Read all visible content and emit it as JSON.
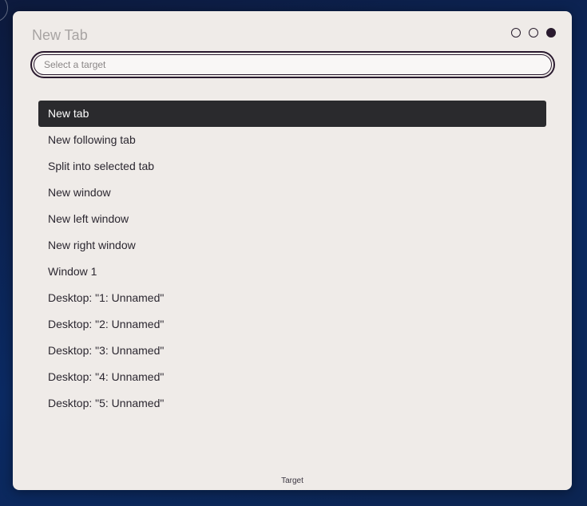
{
  "dialog": {
    "title": "New Tab",
    "search": {
      "placeholder": "Select a target",
      "value": ""
    },
    "items": [
      {
        "label": "New tab",
        "selected": true
      },
      {
        "label": "New following tab",
        "selected": false
      },
      {
        "label": "Split into selected tab",
        "selected": false
      },
      {
        "label": "New window",
        "selected": false
      },
      {
        "label": "New left window",
        "selected": false
      },
      {
        "label": "New right window",
        "selected": false
      },
      {
        "label": "Window 1",
        "selected": false
      },
      {
        "label": "Desktop: \"1: Unnamed\"",
        "selected": false
      },
      {
        "label": "Desktop: \"2: Unnamed\"",
        "selected": false
      },
      {
        "label": "Desktop: \"3: Unnamed\"",
        "selected": false
      },
      {
        "label": "Desktop: \"4: Unnamed\"",
        "selected": false
      },
      {
        "label": "Desktop: \"5: Unnamed\"",
        "selected": false
      }
    ],
    "footer": "Target",
    "step_indicator": {
      "total": 3,
      "current": 3,
      "icons": [
        "step-dot-icon",
        "step-dot-icon",
        "step-dot-active-icon"
      ]
    }
  },
  "colors": {
    "background": "#0b2a63",
    "dialog": "#efebe8",
    "selected_item": "#2a2a2d",
    "accent": "#2a1a2f"
  }
}
